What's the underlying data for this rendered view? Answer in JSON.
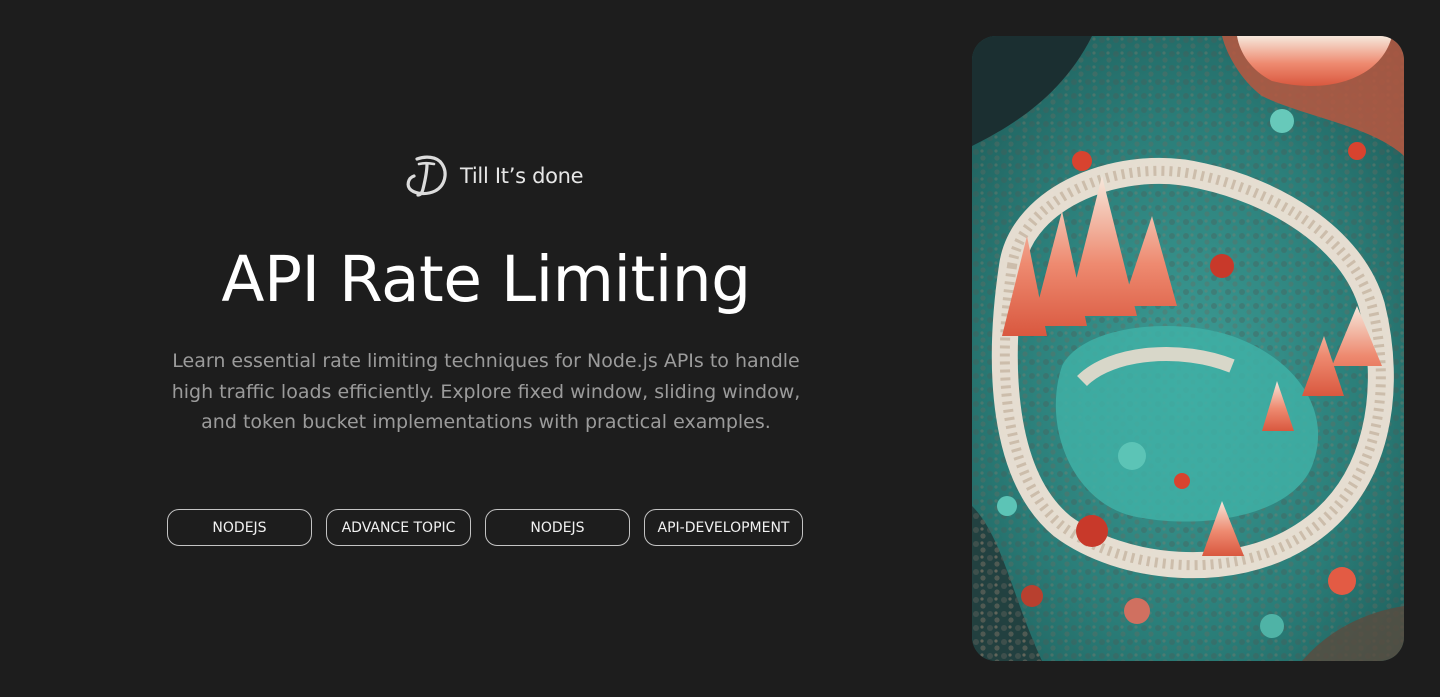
{
  "brand": {
    "name": "Till It’s done",
    "logo_icon": "signature-d-logo-icon"
  },
  "hero": {
    "title": "API Rate Limiting",
    "description": "Learn essential rate limiting techniques for Node.js APIs to handle high traffic loads efficiently. Explore fixed window, sliding window, and token bucket implementations with practical examples."
  },
  "tags": [
    {
      "label": "NODEJS"
    },
    {
      "label": "ADVANCE TOPIC"
    },
    {
      "label": "NODEJS"
    },
    {
      "label": "API-DEVELOPMENT"
    }
  ],
  "image": {
    "subject": "coral-reef-artwork-image"
  },
  "colors": {
    "background": "#1d1d1d",
    "title": "#ffffff",
    "description": "#9b9b9b",
    "tag_border": "#c4c4c4",
    "reef_teal": "#2f8f8a",
    "reef_coral": "#e8705a",
    "reef_cream": "#efe3d6"
  }
}
